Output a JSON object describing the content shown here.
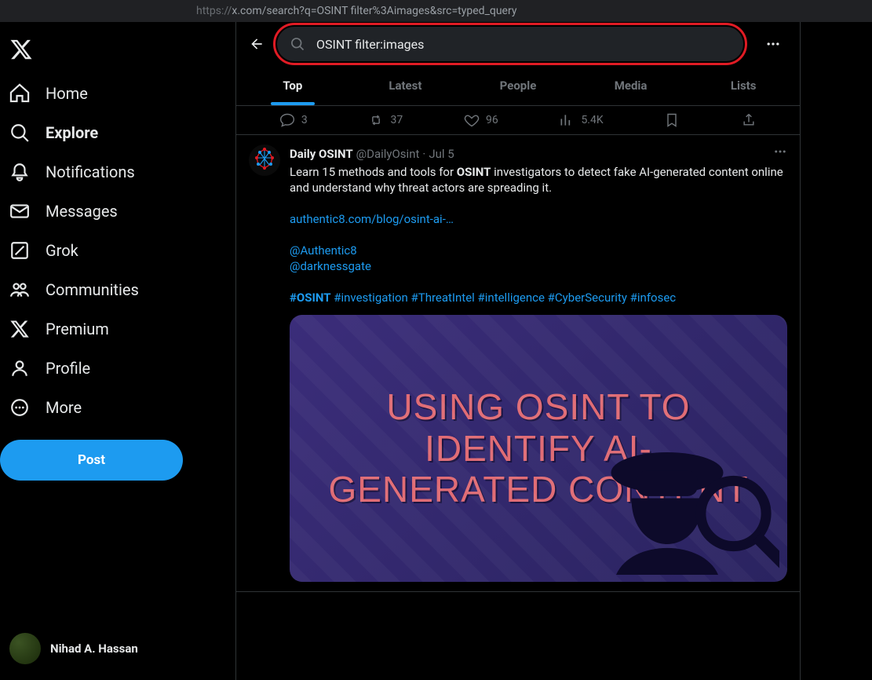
{
  "address_bar": {
    "url_prefix": "https://",
    "url_rest": "x.com/search?q=OSINT filter%3Aimages&src=typed_query"
  },
  "sidebar": {
    "items": [
      {
        "key": "home",
        "label": "Home"
      },
      {
        "key": "explore",
        "label": "Explore",
        "active": true
      },
      {
        "key": "notifications",
        "label": "Notifications"
      },
      {
        "key": "messages",
        "label": "Messages"
      },
      {
        "key": "grok",
        "label": "Grok"
      },
      {
        "key": "communities",
        "label": "Communities"
      },
      {
        "key": "premium",
        "label": "Premium"
      },
      {
        "key": "profile",
        "label": "Profile"
      },
      {
        "key": "more",
        "label": "More"
      }
    ],
    "post_button": "Post",
    "account_name": "Nihad A. Hassan"
  },
  "search": {
    "value": "OSINT filter:images"
  },
  "tabs": [
    "Top",
    "Latest",
    "People",
    "Media",
    "Lists"
  ],
  "active_tab": 0,
  "engagement": {
    "replies": "3",
    "retweets": "37",
    "likes": "96",
    "views": "5.4K"
  },
  "tweet": {
    "author": "Daily OSINT",
    "handle": "@DailyOsint",
    "date": "Jul 5",
    "text_parts": {
      "p1a": "Learn 15 methods and tools for ",
      "p1_bold": "OSINT",
      "p1b": " investigators to detect fake AI-generated content online and understand why threat actors are spreading it.",
      "link": "authentic8.com/blog/osint-ai-…",
      "mention1": "@Authentic8",
      "mention2": "@darknessgate",
      "hash_bold": "#OSINT",
      "hashes": " #investigation #ThreatIntel #intelligence #CyberSecurity #infosec"
    },
    "media_headline": "USING OSINT TO IDENTIFY AI-GENERATED CONTENT"
  }
}
